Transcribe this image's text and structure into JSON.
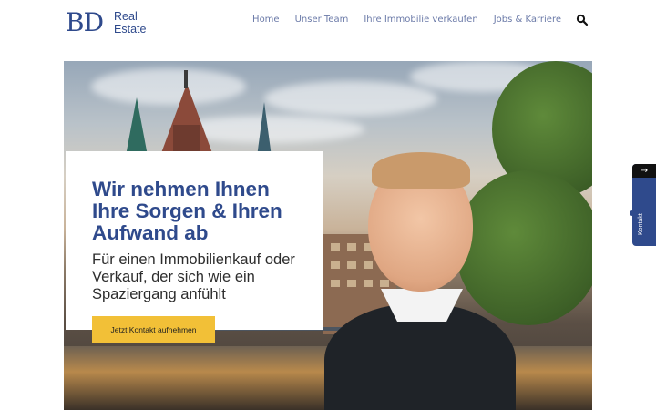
{
  "header": {
    "logo": {
      "mark": "BD",
      "line1": "Real",
      "line2": "Estate"
    },
    "nav": [
      {
        "label": "Home"
      },
      {
        "label": "Unser Team"
      },
      {
        "label": "Ihre Immobilie verkaufen"
      },
      {
        "label": "Jobs & Karriere"
      }
    ],
    "search_icon": "search-icon"
  },
  "hero": {
    "headline": "Wir nehmen Ihnen Ihre Sorgen & Ihren Aufwand ab",
    "subline": "Für einen Immobilienkauf oder Verkauf, der sich wie ein Spaziergang anfühlt",
    "cta_label": "Jetzt Kontakt aufnehmen"
  },
  "side_tab": {
    "arrow": "→",
    "label": "Kontakt"
  },
  "colors": {
    "brand": "#2f4a8c",
    "accent": "#f2c037",
    "nav": "#6b7aa8"
  }
}
